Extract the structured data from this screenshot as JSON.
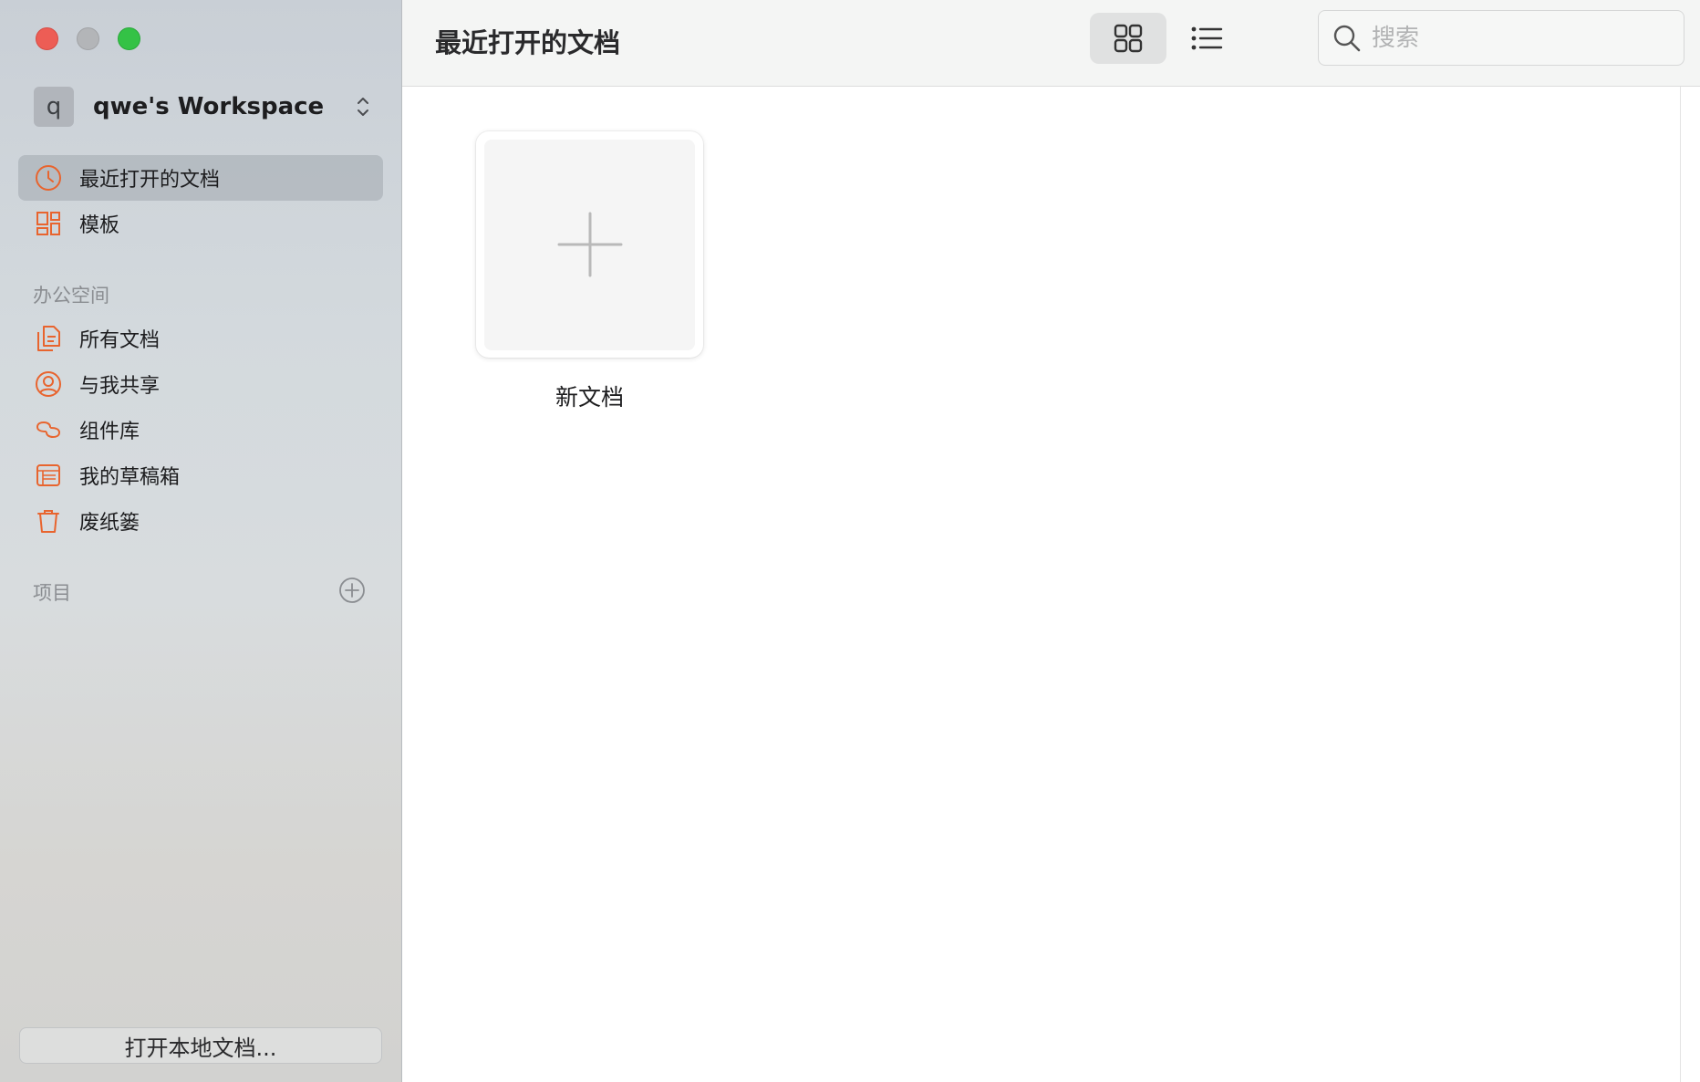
{
  "window": {
    "controls": [
      "close",
      "minimize",
      "maximize"
    ],
    "colors": {
      "close": "#ed5d55",
      "minimize": "#b3b5b8",
      "maximize": "#34c246"
    }
  },
  "sidebar": {
    "workspace": {
      "avatar_letter": "q",
      "name": "qwe's Workspace"
    },
    "top_items": [
      {
        "label": "最近打开的文档",
        "icon": "clock-icon",
        "active": true
      },
      {
        "label": "模板",
        "icon": "template-icon",
        "active": false
      }
    ],
    "office_section_title": "办公空间",
    "office_items": [
      {
        "label": "所有文档",
        "icon": "documents-icon"
      },
      {
        "label": "与我共享",
        "icon": "person-icon"
      },
      {
        "label": "组件库",
        "icon": "link-icon"
      },
      {
        "label": "我的草稿箱",
        "icon": "drafts-icon"
      },
      {
        "label": "废纸篓",
        "icon": "trash-icon"
      }
    ],
    "projects_section_title": "项目",
    "open_local_button": "打开本地文档...",
    "accent_color": "#e8642e"
  },
  "toolbar": {
    "title": "最近打开的文档",
    "view_mode": "grid",
    "search_placeholder": "搜索"
  },
  "content": {
    "new_document_label": "新文档"
  }
}
